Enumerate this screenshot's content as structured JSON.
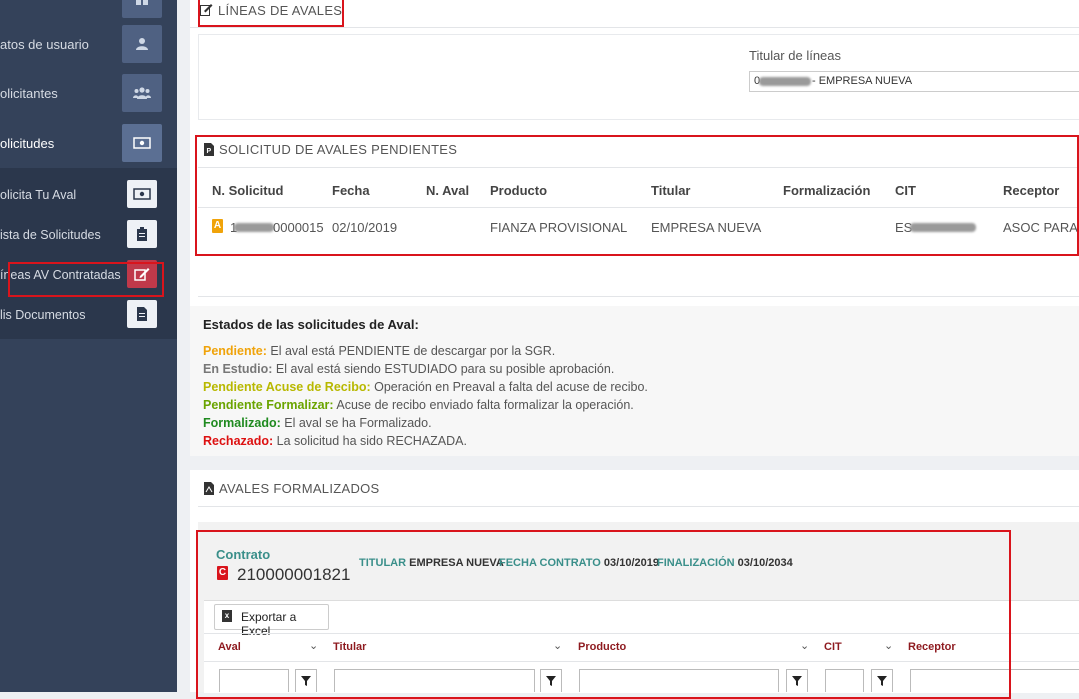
{
  "sidebar": {
    "items": [
      {
        "label": "atos de usuario"
      },
      {
        "label": "olicitantes"
      },
      {
        "label": "olicitudes"
      }
    ],
    "sub_items": [
      {
        "label": "olicita Tu Aval"
      },
      {
        "label": "ista de Solicitudes"
      },
      {
        "label": "íneas AV Contratadas"
      },
      {
        "label": "lis Documentos"
      }
    ]
  },
  "lines_section": {
    "title": "LÍNEAS DE AVALES",
    "holder_label": "Titular de líneas",
    "holder_value_redacted": "0",
    "holder_value": " - EMPRESA NUEVA"
  },
  "pending_section": {
    "title": "SOLICITUD DE AVALES PENDIENTES",
    "columns": [
      "N. Solicitud",
      "Fecha",
      "N. Aval",
      "Producto",
      "Titular",
      "Formalización",
      "CIT",
      "Receptor"
    ],
    "row": {
      "status_letter": "A",
      "solicitud_prefix": "1",
      "solicitud_suffix": "0000015",
      "fecha": "02/10/2019",
      "aval": "",
      "producto": "FIANZA PROVISIONAL",
      "titular": "EMPRESA NUEVA",
      "formalizacion": "",
      "cit_prefix": "ES",
      "cit_suffix": "",
      "receptor": "ASOC PARA E"
    }
  },
  "states": {
    "title": "Estados de las solicitudes de Aval:",
    "items": [
      {
        "name": "Pendiente:",
        "text": " El aval está PENDIENTE de descargar por la SGR.",
        "color": "#f0a30a"
      },
      {
        "name": "En Estudio:",
        "text": " El aval está siendo ESTUDIADO para su posible aprobación.",
        "color": "#777777"
      },
      {
        "name": "Pendiente Acuse de Recibo:",
        "text": " Operación en Preaval a falta del acuse de recibo.",
        "color": "#b8b800"
      },
      {
        "name": "Pendiente Formalizar:",
        "text": " Acuse de recibo enviado falta formalizar la operación.",
        "color": "#6aa400"
      },
      {
        "name": "Formalizado:",
        "text": " El aval se ha Formalizado.",
        "color": "#1f8a1f"
      },
      {
        "name": "Rechazado:",
        "text": " La solicitud ha sido RECHAZADA.",
        "color": "#dd1111"
      }
    ]
  },
  "formalized_section": {
    "title": "AVALES FORMALIZADOS",
    "contract_label": "Contrato",
    "contract_letter": "C",
    "contract_number": "210000001821",
    "titular_label": "TITULAR",
    "titular_value": "EMPRESA NUEVA",
    "fecha_label": "FECHA CONTRATO",
    "fecha_value": "03/10/2019",
    "fin_label": "FINALIZACIÓN",
    "fin_value": "03/10/2034",
    "export_label": "Exportar a Excel",
    "export_icon": "x",
    "grid_columns": [
      "Aval",
      "Titular",
      "Producto",
      "CIT",
      "Receptor"
    ]
  }
}
